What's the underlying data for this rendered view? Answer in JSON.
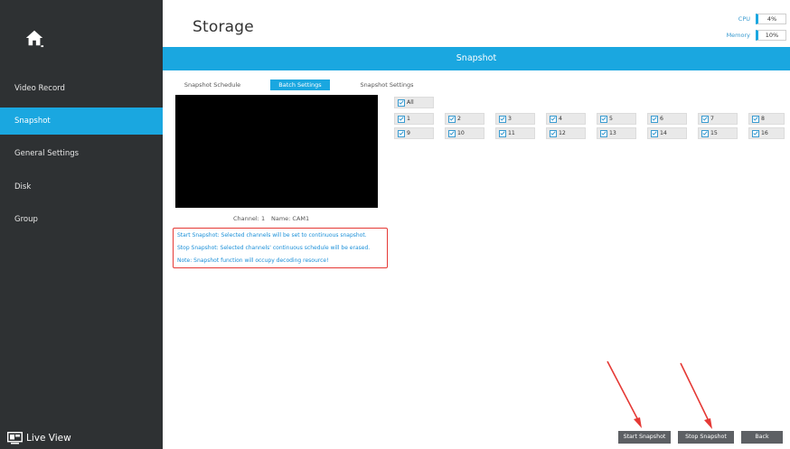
{
  "sidebar": {
    "items": [
      {
        "label": "Video Record"
      },
      {
        "label": "Snapshot"
      },
      {
        "label": "General Settings"
      },
      {
        "label": "Disk"
      },
      {
        "label": "Group"
      }
    ],
    "live_view": "Live View"
  },
  "header": {
    "title": "Storage",
    "cpu_label": "CPU",
    "cpu_value": "4%",
    "memory_label": "Memory",
    "memory_value": "10%"
  },
  "section": {
    "title": "Snapshot"
  },
  "tabs": [
    {
      "label": "Snapshot Schedule",
      "active": false
    },
    {
      "label": "Batch Settings",
      "active": true
    },
    {
      "label": "Snapshot Settings",
      "active": false
    }
  ],
  "channel": {
    "label": "Channel: 1",
    "name": "Name: CAM1"
  },
  "notes": [
    "Start Snapshot: Selected channels will be set to continuous snapshot.",
    "Stop Snapshot: Selected channels' continuous schedule will be erased.",
    "Note: Snapshot function will occupy decoding resource!"
  ],
  "channels": {
    "all_label": "All",
    "list": [
      "1",
      "2",
      "3",
      "4",
      "5",
      "6",
      "7",
      "8",
      "9",
      "10",
      "11",
      "12",
      "13",
      "14",
      "15",
      "16"
    ],
    "checked": true
  },
  "buttons": {
    "start": "Start Snapshot",
    "stop": "Stop Snapshot",
    "back": "Back"
  },
  "colors": {
    "accent": "#1aa7e0",
    "sidebar": "#2e3133",
    "annotation": "#e53935"
  }
}
